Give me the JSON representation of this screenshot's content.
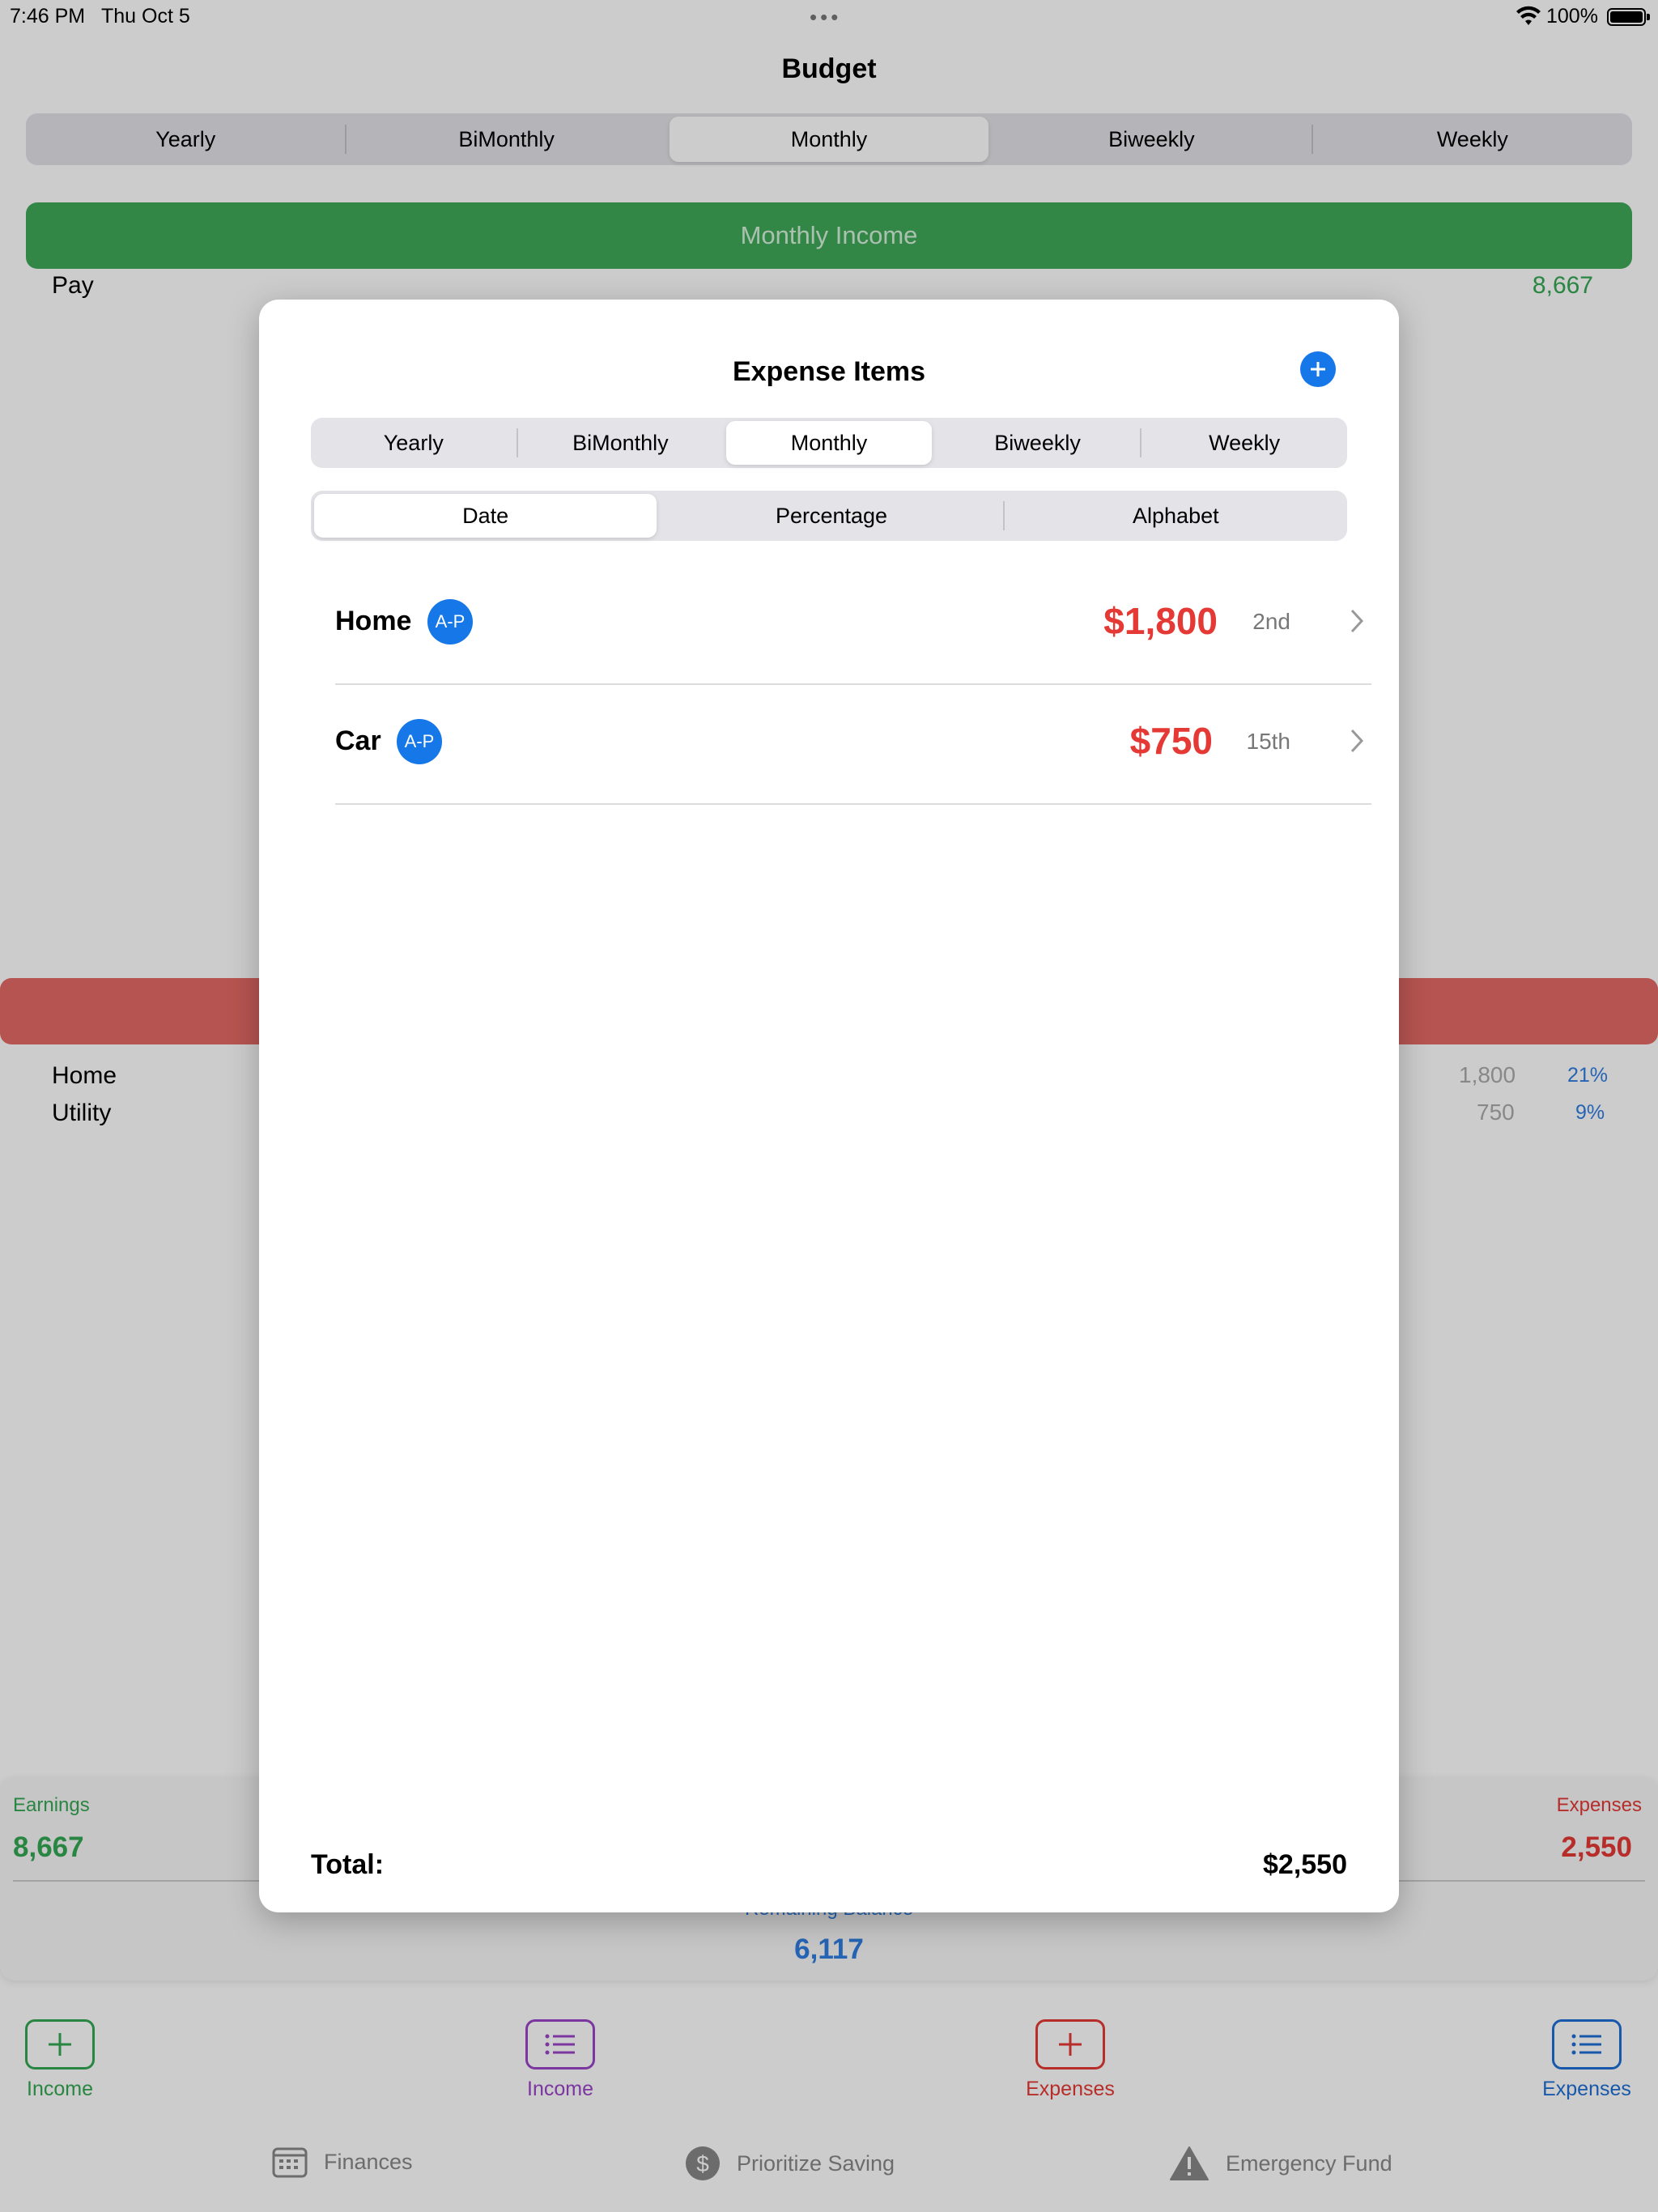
{
  "status": {
    "time": "7:46 PM",
    "date": "Thu Oct 5",
    "battery": "100%"
  },
  "page": {
    "title": "Budget"
  },
  "periods": [
    "Yearly",
    "BiMonthly",
    "Monthly",
    "Biweekly",
    "Weekly"
  ],
  "selected_period": "Monthly",
  "income": {
    "header": "Monthly Income",
    "items": [
      {
        "label": "Pay",
        "value": "8,667"
      }
    ]
  },
  "expenses_bg": {
    "items": [
      {
        "label": "Home",
        "value": "1,800",
        "pct": "21%"
      },
      {
        "label": "Utility",
        "value": "750",
        "pct": "9%"
      }
    ]
  },
  "summary": {
    "earnings_label": "Earnings",
    "earnings_value": "8,667",
    "expenses_label": "Expenses",
    "expenses_value": "2,550",
    "remaining_label": "Remaining Balance",
    "remaining_value": "6,117"
  },
  "actions": [
    {
      "label": "Income",
      "color": "#34a853",
      "icon": "plus-icon"
    },
    {
      "label": "Income",
      "color": "#9b44c9",
      "icon": "list-icon"
    },
    {
      "label": "Expenses",
      "color": "#e53935",
      "icon": "plus-icon"
    },
    {
      "label": "Expenses",
      "color": "#1f6fd6",
      "icon": "list-icon"
    }
  ],
  "tabs": [
    {
      "label": "Finances",
      "icon": "calendar-icon"
    },
    {
      "label": "Prioritize Saving",
      "icon": "dollar-icon"
    },
    {
      "label": "Emergency Fund",
      "icon": "warning-icon"
    }
  ],
  "modal": {
    "title": "Expense Items",
    "periods": [
      "Yearly",
      "BiMonthly",
      "Monthly",
      "Biweekly",
      "Weekly"
    ],
    "selected_period": "Monthly",
    "sort_options": [
      "Date",
      "Percentage",
      "Alphabet"
    ],
    "selected_sort": "Date",
    "items": [
      {
        "name": "Home",
        "badge": "A-P",
        "amount": "$1,800",
        "date": "2nd"
      },
      {
        "name": "Car",
        "badge": "A-P",
        "amount": "$750",
        "date": "15th"
      }
    ],
    "total_label": "Total:",
    "total_value": "$2,550"
  }
}
